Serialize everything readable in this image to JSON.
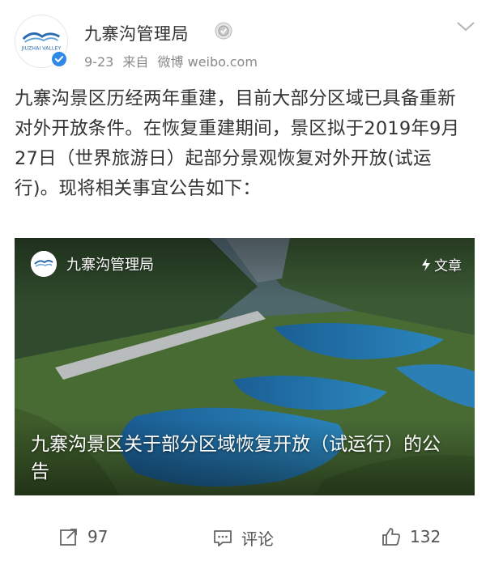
{
  "post": {
    "author": "九寨沟管理局",
    "date": "9-23",
    "source_prefix": "来自",
    "source": "微博 weibo.com",
    "avatar_logo_text": "JIUZHAI VALLEY",
    "text": "九寨沟景区历经两年重建，目前大部分区域已具备重新对外开放条件。在恢复重建期间，景区拟于2019年9月27日（世界旅游日）起部分景观恢复对外开放(试运行)。现将相关事宜公告如下："
  },
  "card": {
    "source_name": "九寨沟管理局",
    "type_label": "文章",
    "title": "九寨沟景区关于部分区域恢复开放（试运行）的公告"
  },
  "actions": {
    "repost_count": "97",
    "comment_label": "评论",
    "like_count": "132"
  },
  "colors": {
    "verified": "#2f8ae5",
    "text": "#333333",
    "meta": "#8a8a8a",
    "lake": "#1e6fa8"
  },
  "icons": [
    "verified-icon",
    "medal-icon",
    "chevron-down-icon",
    "lightning-icon",
    "repost-icon",
    "comment-icon",
    "like-icon"
  ]
}
